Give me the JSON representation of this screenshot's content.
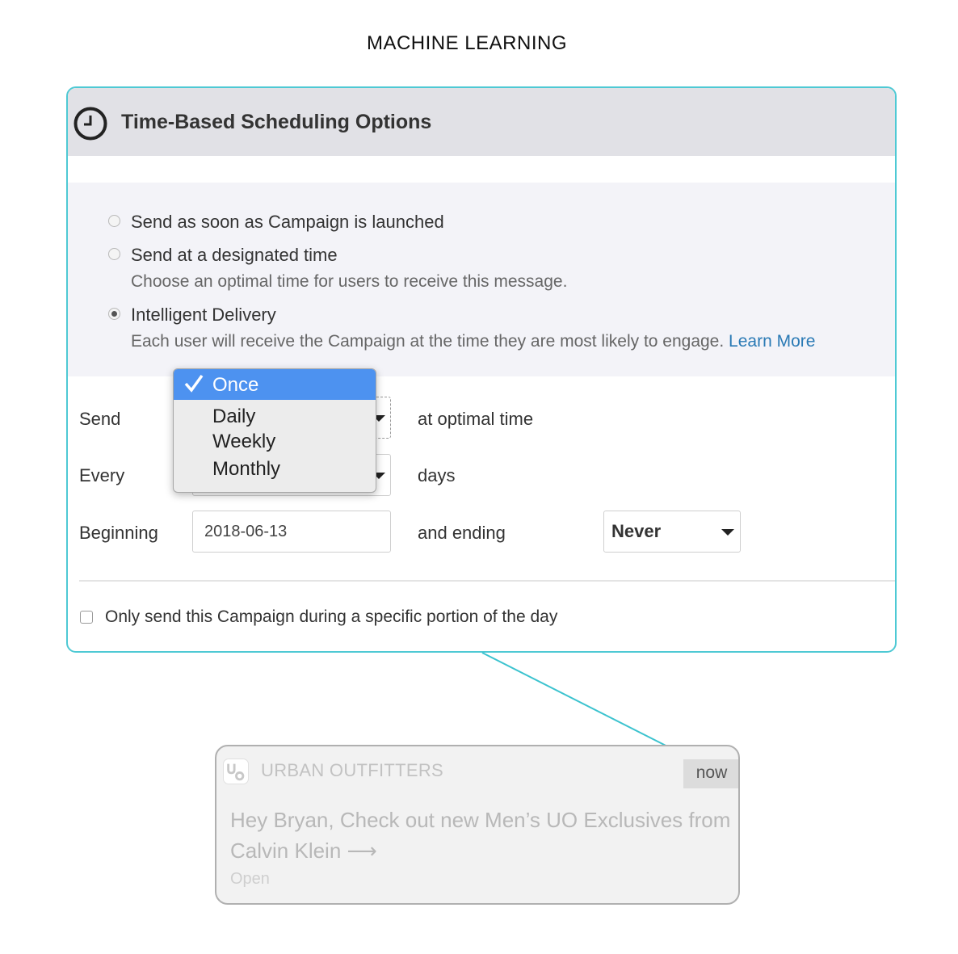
{
  "page_title": "MACHINE LEARNING",
  "panel": {
    "title": "Time-Based Scheduling Options",
    "icon": "clock-icon",
    "accent_color": "#4ec9d4"
  },
  "delivery_options": [
    {
      "label": "Send as soon as Campaign is launched",
      "checked": false
    },
    {
      "label": "Send at a designated time",
      "description": "Choose an optimal time for users to receive this message.",
      "checked": false
    },
    {
      "label": "Intelligent Delivery",
      "description": "Each user will receive the Campaign at the time they are most likely to engage.",
      "link": "Learn More",
      "checked": true
    }
  ],
  "schedule": {
    "send_label": "Send",
    "send_suffix": "at optimal time",
    "every_label": "Every",
    "every_suffix": "days",
    "beginning_label": "Beginning",
    "beginning_value": "2018-06-13",
    "ending_label": "and ending",
    "ending_value": "Never"
  },
  "frequency_menu": {
    "options": [
      "Once",
      "Daily",
      "Weekly",
      "Monthly"
    ],
    "selected": "Once",
    "highlight_color": "#4d92f0"
  },
  "portion_of_day": {
    "label": "Only send this Campaign during a specific portion of the day",
    "checked": false
  },
  "notification": {
    "app_name": "URBAN OUTFITTERS",
    "time": "now",
    "message": "Hey Bryan, Check out new Men’s UO Exclusives from Calvin Klein ⟶",
    "action": "Open"
  }
}
